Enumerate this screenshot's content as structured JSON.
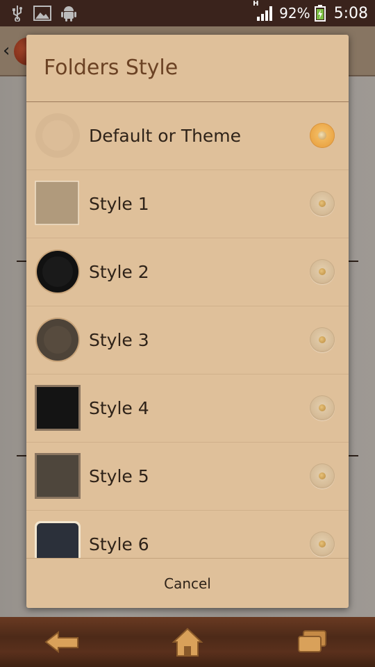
{
  "status_bar": {
    "network_type": "H",
    "battery_percent": "92%",
    "time": "5:08",
    "icons": [
      "usb-icon",
      "image-icon",
      "android-icon",
      "signal-icon",
      "battery-charging-icon"
    ]
  },
  "dialog": {
    "title": "Folders Style",
    "options": [
      {
        "label": "Default or Theme",
        "selected": true,
        "thumb": "faded-circle"
      },
      {
        "label": "Style 1",
        "selected": false,
        "thumb": "tan-square"
      },
      {
        "label": "Style 2",
        "selected": false,
        "thumb": "black-circle"
      },
      {
        "label": "Style 3",
        "selected": false,
        "thumb": "brown-circle"
      },
      {
        "label": "Style 4",
        "selected": false,
        "thumb": "black-square"
      },
      {
        "label": "Style 5",
        "selected": false,
        "thumb": "brown-square"
      },
      {
        "label": "Style 6",
        "selected": false,
        "thumb": "denim-square"
      }
    ],
    "cancel_label": "Cancel"
  },
  "nav_bar": {
    "buttons": [
      "back-icon",
      "home-icon",
      "recent-apps-icon"
    ]
  }
}
